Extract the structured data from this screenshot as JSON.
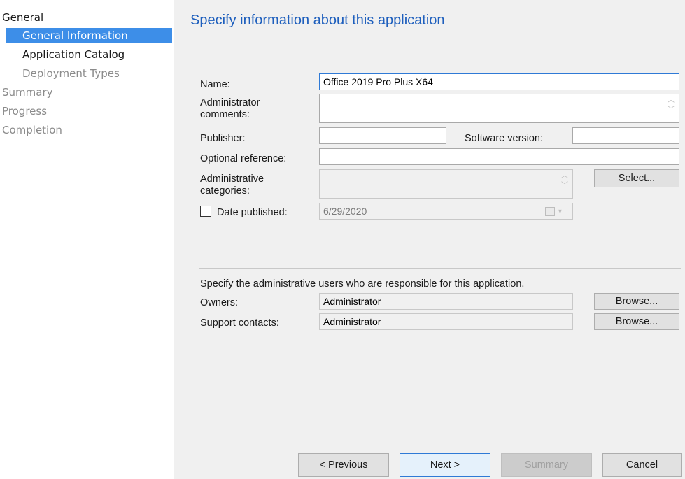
{
  "nav": {
    "items": [
      {
        "label": "General",
        "state": "dark"
      },
      {
        "label": "General Information",
        "state": "selected"
      },
      {
        "label": "Application Catalog",
        "state": "dark"
      },
      {
        "label": "Deployment Types",
        "state": "dim"
      },
      {
        "label": "Summary",
        "state": "dim"
      },
      {
        "label": "Progress",
        "state": "dim"
      },
      {
        "label": "Completion",
        "state": "dim"
      }
    ]
  },
  "page": {
    "title": "Specify information about this application"
  },
  "form": {
    "name_label": "Name:",
    "name_value": "Office 2019 Pro Plus X64",
    "admin_comments_label_1": "Administrator",
    "admin_comments_label_2": "comments:",
    "admin_comments_value": "",
    "publisher_label": "Publisher:",
    "publisher_value": "",
    "software_version_label": "Software version:",
    "software_version_value": "",
    "optional_reference_label": "Optional reference:",
    "optional_reference_value": "",
    "admin_categories_label_1": "Administrative",
    "admin_categories_label_2": "categories:",
    "select_button": "Select...",
    "date_published_label": "Date published:",
    "date_published_value": "6/29/2020",
    "date_published_checked": false
  },
  "owners_section": {
    "description": "Specify the administrative users who are responsible for this application.",
    "owners_label": "Owners:",
    "owners_value": "Administrator",
    "support_contacts_label": "Support contacts:",
    "support_contacts_value": "Administrator",
    "browse_label": "Browse..."
  },
  "footer": {
    "previous": "< Previous",
    "next": "Next >",
    "summary": "Summary",
    "cancel": "Cancel"
  },
  "colors": {
    "accent": "#3d8ee8",
    "title": "#1e5fbd",
    "panel": "#f0f0f0"
  }
}
